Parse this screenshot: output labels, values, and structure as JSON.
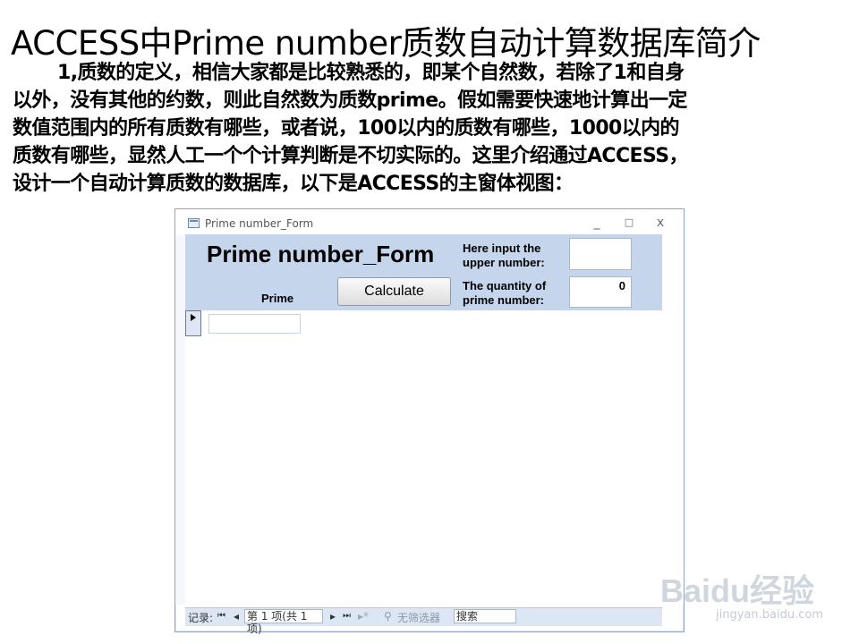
{
  "slide": {
    "title": "ACCESS中Prime number质数自动计算数据库简介",
    "paragraph_lines": [
      "1,质数的定义，相信大家都是比较熟悉的，即某个自然数，若除了1和自身",
      "以外，没有其他的约数，则此自然数为质数prime。假如需要快速地计算出一定",
      "数值范围内的所有质数有哪些，或者说，100以内的质数有哪些，1000以内的",
      "质数有哪些，显然人工一个个计算判断是不切实际的。这里介绍通过ACCESS，",
      "设计一个自动计算质数的数据库，以下是ACCESS的主窗体视图："
    ]
  },
  "window": {
    "title": "Prime number_Form",
    "minimize": "_",
    "maximize": "□",
    "close": "x"
  },
  "form": {
    "heading": "Prime number_Form",
    "upper_label": "Here input the upper number:",
    "upper_value": "",
    "quantity_label": "The quantity of prime number:",
    "quantity_value": "0",
    "calculate_label": "Calculate",
    "prime_column_label": "Prime",
    "prime_value": ""
  },
  "navbar": {
    "record_label": "记录:",
    "first": "⏮",
    "prev": "◂",
    "position": "第 1 项(共 1 项)",
    "next": "▸",
    "last": "⏭",
    "new": "▸*",
    "filter": "无筛选器",
    "search": "搜索"
  },
  "watermark": {
    "logo": "Baidu经验",
    "url": "jingyan.baidu.com"
  }
}
